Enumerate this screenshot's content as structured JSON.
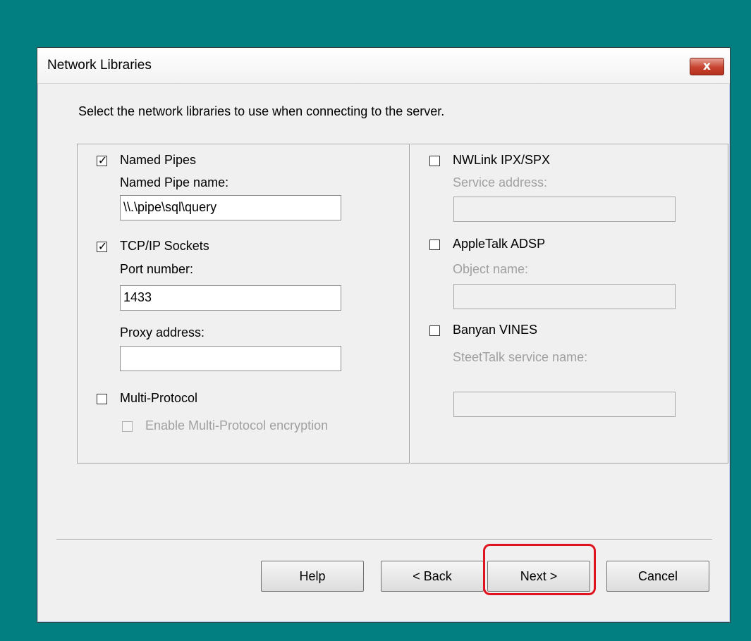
{
  "dialog": {
    "title": "Network Libraries",
    "close_glyph": "x",
    "instruction": "Select the network libraries to use when connecting to the server."
  },
  "left": {
    "named_pipes": {
      "label": "Named Pipes",
      "checked": true,
      "field_label": "Named Pipe name:",
      "value": "\\\\.\\pipe\\sql\\query"
    },
    "tcpip": {
      "label": "TCP/IP Sockets",
      "checked": true,
      "port_label": "Port number:",
      "port_value": "1433",
      "proxy_label": "Proxy address:",
      "proxy_value": ""
    },
    "multi_protocol": {
      "label": "Multi-Protocol",
      "checked": false,
      "encryption_label": "Enable Multi-Protocol encryption",
      "encryption_checked": false
    }
  },
  "right": {
    "nwlink": {
      "label": "NWLink IPX/SPX",
      "checked": false,
      "field_label": "Service address:",
      "value": ""
    },
    "appletalk": {
      "label": "AppleTalk ADSP",
      "checked": false,
      "field_label": "Object name:",
      "value": ""
    },
    "banyan": {
      "label": "Banyan VINES",
      "checked": false,
      "field_label": "SteetTalk service name:",
      "value": ""
    }
  },
  "buttons": {
    "help": "Help",
    "back": "< Back",
    "next": "Next >",
    "cancel": "Cancel"
  },
  "colors": {
    "desktop": "#027f80",
    "dialog": "#f0f0f0",
    "highlight": "#e0141e"
  }
}
